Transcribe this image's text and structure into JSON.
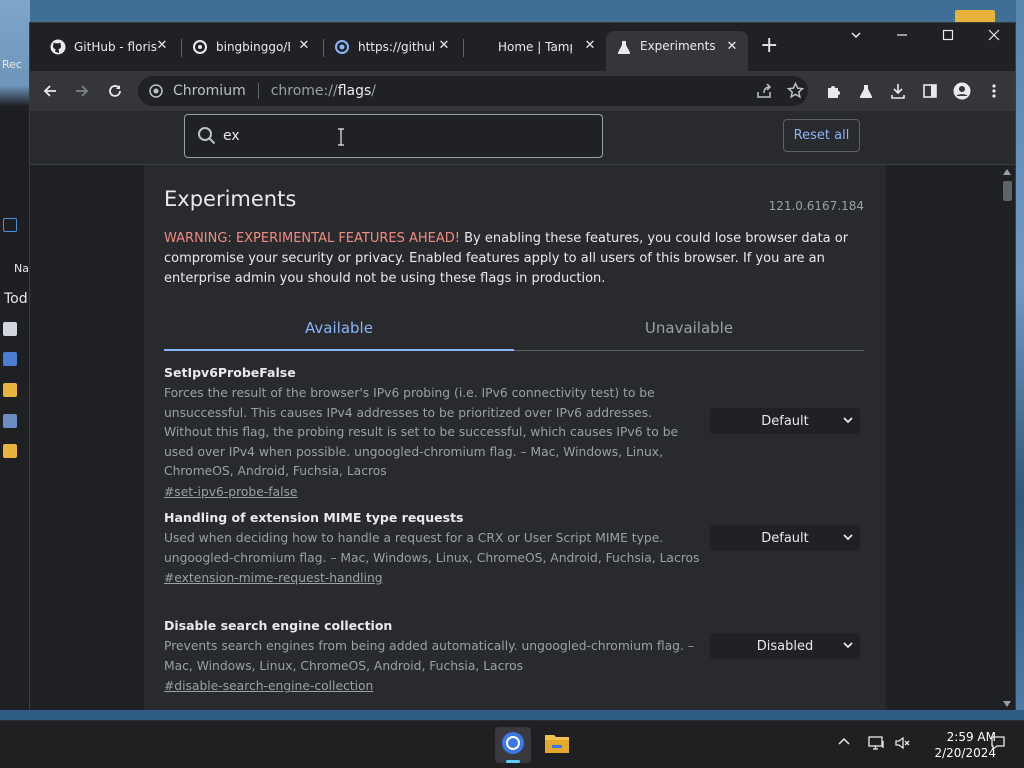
{
  "browser": {
    "tabs": [
      {
        "title": "GitHub - floris",
        "icon": "github-icon",
        "active": false
      },
      {
        "title": "bingbinggo/B",
        "icon": "tampermonkey-icon",
        "active": false
      },
      {
        "title": "https://github",
        "icon": "loading-icon",
        "active": false
      },
      {
        "title": "Home | Tampe",
        "icon": "none",
        "active": false
      },
      {
        "title": "Experiments",
        "icon": "flask-icon",
        "active": true
      }
    ],
    "new_tab_label": "+",
    "toolbar": {
      "site_label": "Chromium",
      "url_scheme": "chrome://",
      "url_host": "flags",
      "url_tail": "/"
    }
  },
  "flags_page": {
    "search_value": "ex",
    "reset_label": "Reset all",
    "title": "Experiments",
    "version": "121.0.6167.184",
    "warning_red": "WARNING: EXPERIMENTAL FEATURES AHEAD!",
    "warning_rest": " By enabling these features, you could lose browser data or compromise your security or privacy. Enabled features apply to all users of this browser. If you are an enterprise admin you should not be using these flags in production.",
    "tabs": {
      "available": "Available",
      "unavailable": "Unavailable"
    },
    "flags": [
      {
        "name": "SetIpv6ProbeFalse",
        "description": "Forces the result of the browser's IPv6 probing (i.e. IPv6 connectivity test) to be unsuccessful. This causes IPv4 addresses to be prioritized over IPv6 addresses. Without this flag, the probing result is set to be successful, which causes IPv6 to be used over IPv4 when possible. ungoogled-chromium flag. – Mac, Windows, Linux, ChromeOS, Android, Fuchsia, Lacros",
        "link": "#set-ipv6-probe-false",
        "value": "Default"
      },
      {
        "name": "Handling of extension MIME type requests",
        "description": "Used when deciding how to handle a request for a CRX or User Script MIME type. ungoogled-chromium flag. – Mac, Windows, Linux, ChromeOS, Android, Fuchsia, Lacros",
        "link": "#extension-mime-request-handling",
        "value": "Default"
      },
      {
        "name": "Disable search engine collection",
        "description": "Prevents search engines from being added automatically. ungoogled-chromium flag. – Mac, Windows, Linux, ChromeOS, Android, Fuchsia, Lacros",
        "link": "#disable-search-engine-collection",
        "value": "Disabled"
      }
    ]
  },
  "desktop": {
    "left_labels": [
      "Rec",
      "Na",
      "Tod"
    ]
  },
  "taskbar": {
    "apps": [
      {
        "name": "chromium",
        "icon": "chromium-icon",
        "active": true
      },
      {
        "name": "file-explorer",
        "icon": "folder-icon",
        "active": false
      }
    ],
    "time": "2:59 AM",
    "date": "2/20/2024"
  },
  "colors": {
    "accent": "#8ab4f8",
    "warning": "#f28b82",
    "page_bg": "#202124",
    "card_bg": "#292a2d"
  }
}
